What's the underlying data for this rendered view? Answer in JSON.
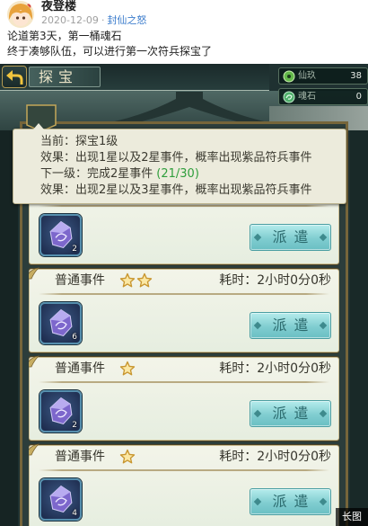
{
  "post": {
    "author": "夜登楼",
    "date": "2020-12-09",
    "separator": "·",
    "topic": "封仙之怒",
    "lines": [
      "论道第3天，第一桶魂石",
      "终于凑够队伍，可以进行第一次符兵探宝了"
    ]
  },
  "game": {
    "title": "探宝",
    "back_icon": "back-arrow-icon",
    "resources": [
      {
        "name": "仙玖",
        "value": "38",
        "icon": "xianjiu-currency-icon"
      },
      {
        "name": "魂石",
        "value": "0",
        "icon": "soul-stone-icon"
      }
    ],
    "tooltip": {
      "current_label": "当前：",
      "current_value": "探宝1级",
      "effect_label": "效果：",
      "effect_current": "出现1星以及2星事件，概率出现紫品符兵事件",
      "next_label": "下一级：",
      "next_value": "完成2星事件",
      "next_progress": "(21/30)",
      "effect_next": "出现2星以及3星事件，概率出现紫品符兵事件"
    },
    "events": [
      {
        "count": "2",
        "button": "派遣",
        "icon": "reward-gem-icon"
      },
      {
        "name": "普通事件",
        "stars": 2,
        "duration_label": "耗时：",
        "duration": "2小时0分0秒",
        "count": "6",
        "button": "派遣",
        "icon": "reward-gem-icon"
      },
      {
        "name": "普通事件",
        "stars": 1,
        "duration_label": "耗时：",
        "duration": "2小时0分0秒",
        "count": "2",
        "button": "派遣",
        "icon": "reward-gem-icon"
      },
      {
        "name": "普通事件",
        "stars": 1,
        "duration_label": "耗时：",
        "duration": "2小时0分0秒",
        "count": "4",
        "button": "派遣",
        "icon": "reward-gem-icon"
      }
    ]
  },
  "badge": "长图",
  "colors": {
    "topic_link": "#3b7ccc",
    "progress": "#2f9e3c",
    "button_text": "#2b6a6d"
  }
}
